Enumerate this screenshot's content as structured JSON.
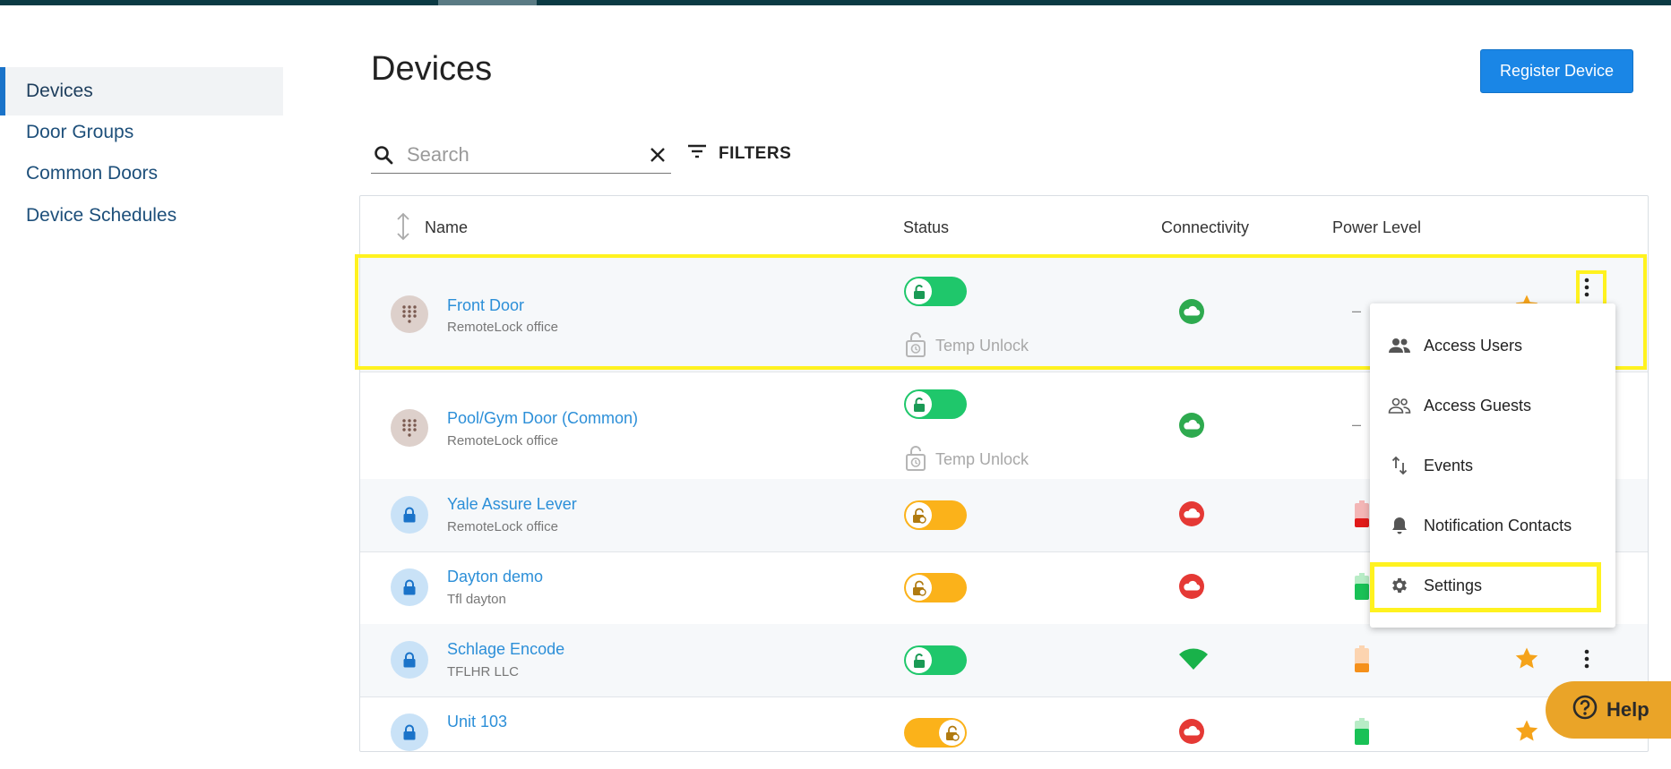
{
  "sidebar": {
    "items": [
      {
        "label": "Devices"
      },
      {
        "label": "Door Groups"
      },
      {
        "label": "Common Doors"
      },
      {
        "label": "Device Schedules"
      }
    ]
  },
  "page": {
    "title": "Devices",
    "register_label": "Register Device"
  },
  "search": {
    "placeholder": "Search",
    "value": ""
  },
  "filters": {
    "label": "FILTERS"
  },
  "table": {
    "columns": {
      "name": "Name",
      "status": "Status",
      "connectivity": "Connectivity",
      "power": "Power Level"
    },
    "rows": [
      {
        "name": "Front Door",
        "location": "RemoteLock office",
        "temp_unlock": "Temp Unlock",
        "power": "–"
      },
      {
        "name": "Pool/Gym Door (Common)",
        "location": "RemoteLock office",
        "temp_unlock": "Temp Unlock",
        "power": "–"
      },
      {
        "name": "Yale Assure Lever",
        "location": "RemoteLock office"
      },
      {
        "name": "Dayton demo",
        "location": "Tfl dayton"
      },
      {
        "name": "Schlage Encode",
        "location": "TFLHR LLC"
      },
      {
        "name": "Unit 103",
        "location": ""
      }
    ]
  },
  "menu": {
    "items": [
      {
        "label": "Access Users",
        "icon": "people-icon"
      },
      {
        "label": "Access Guests",
        "icon": "people-outline-icon"
      },
      {
        "label": "Events",
        "icon": "swap-vertical-icon"
      },
      {
        "label": "Notification Contacts",
        "icon": "bell-icon"
      },
      {
        "label": "Settings",
        "icon": "gear-icon"
      }
    ]
  },
  "help": {
    "label": "Help"
  },
  "colors": {
    "accent": "#1a86e6",
    "highlight": "#fff21f",
    "online": "#2eaa4f",
    "offline": "#e53935",
    "star": "#f5a31a"
  }
}
